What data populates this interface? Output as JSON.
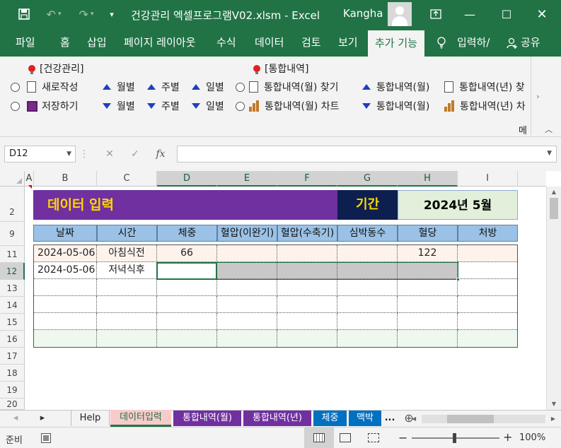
{
  "titlebar": {
    "document_title": "건강관리 엑셀프로그램V02.xlsm  -  Excel",
    "user_name": "Kangha",
    "colors": {
      "excel_green": "#217346"
    }
  },
  "ribbon_tabs": [
    "파일",
    "홈",
    "삽입",
    "페이지 레이아웃",
    "수식",
    "데이터",
    "검토",
    "보기",
    "추가 기능",
    "입력하/",
    "공유"
  ],
  "ribbon": {
    "group_left_title": "[건강관리]",
    "group_right_title": "[통합내역]",
    "new_label": "새로작성",
    "save_label": "저장하기",
    "monthly_up": "월별",
    "weekly_up": "주별",
    "daily_up": "일별",
    "monthly_down": "월별",
    "weekly_down": "주별",
    "daily_down": "일별",
    "find_monthly": "통합내역(월) 찾기",
    "chart_monthly": "통합내역(월) 차트",
    "sort_monthly_up": "통합내역(월)",
    "sort_monthly_down": "통합내역(월)",
    "yearly_top": "통합내역(년) 찾",
    "yearly_bottom": "통합내역(년) 차",
    "overflow_label": "메"
  },
  "formula_bar": {
    "name_box": "D12",
    "formula": ""
  },
  "columns": [
    "A",
    "B",
    "C",
    "D",
    "E",
    "F",
    "G",
    "H",
    "I"
  ],
  "rows": [
    "2",
    "9",
    "11",
    "12",
    "13",
    "14",
    "15",
    "16",
    "17",
    "18",
    "19",
    "20"
  ],
  "sheet": {
    "title": "데이터 입력",
    "period_label": "기간",
    "period_value": "2024년 5월",
    "headers": [
      "날짜",
      "시간",
      "체중",
      "혈압(이완기)",
      "혈압(수축기)",
      "심박동수",
      "혈당",
      "처방"
    ],
    "data_rows": [
      [
        "2024-05-06",
        "아침식전",
        "66",
        "",
        "",
        "",
        "122",
        ""
      ],
      [
        "2024-05-06",
        "저녁식후",
        "",
        "",
        "",
        "",
        "",
        ""
      ]
    ],
    "colors": {
      "title_band": "#7030a0",
      "period_band": "#0d1f4e",
      "header_fill": "#9bc2e6",
      "accent_text": "#ffd700"
    }
  },
  "sheet_tabs": [
    "Help",
    "데이터입력",
    "통합내역(월)",
    "통합내역(년)",
    "체중",
    "맥박",
    "..."
  ],
  "status": {
    "ready": "준비",
    "zoom": "100%"
  }
}
